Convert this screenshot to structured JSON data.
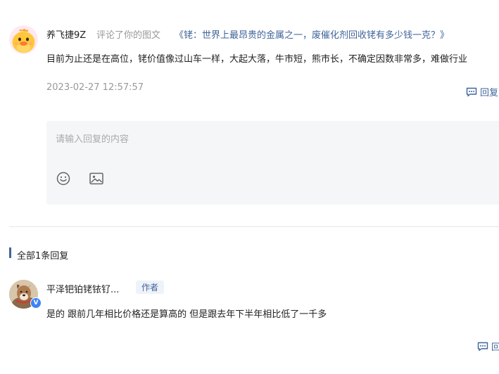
{
  "comment": {
    "username": "养飞捷9Z",
    "action": "评论了你的图文",
    "article_link": "《铑：世界上最昂贵的金属之一，废催化剂回收铑有多少钱一克？》",
    "text": "目前为止还是在高位，铑价值像过山车一样，大起大落，牛市短，熊市长，不确定因数非常多，难做行业",
    "timestamp": "2023-02-27 12:57:57",
    "reply_label": "回复"
  },
  "reply_box": {
    "placeholder": "请输入回复的内容",
    "emoji_icon": "smile-icon",
    "image_icon": "image-icon"
  },
  "replies": {
    "heading": "全部1条回复",
    "items": [
      {
        "username": "平泽钯铂铑铱钌...",
        "badge": "作者",
        "verified_mark": "V",
        "text": "是的 跟前几年相比价格还是算高的 但是跟去年下半年相比低了一千多",
        "reply_label": "回"
      }
    ]
  },
  "colors": {
    "link": "#406599",
    "muted": "#999999",
    "input_bg": "#f5f6f7",
    "badge_bg": "#eef2f9",
    "verified": "#3b82f6"
  }
}
